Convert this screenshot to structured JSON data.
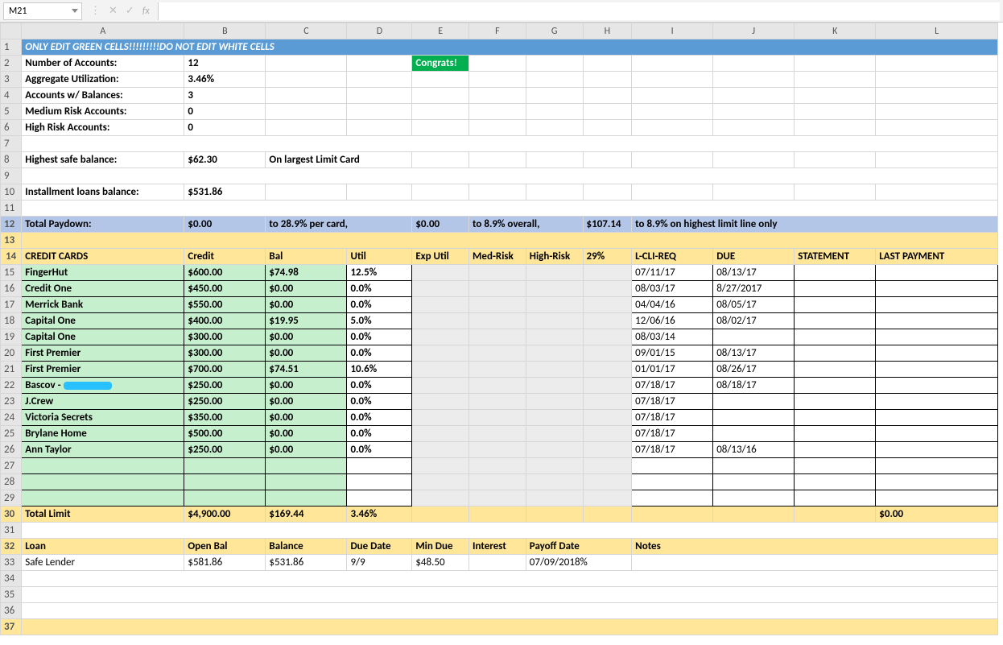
{
  "formula_bar": {
    "name_box": "M21",
    "fx": "fx",
    "value": ""
  },
  "columns": [
    "A",
    "B",
    "C",
    "D",
    "E",
    "F",
    "G",
    "H",
    "I",
    "J",
    "K",
    "L"
  ],
  "row1": {
    "banner": "ONLY EDIT GREEN CELLS!!!!!!!!!DO NOT EDIT WHITE CELLS"
  },
  "congrats": "Congrats!",
  "summary": {
    "num_accounts_label": "Number of Accounts:",
    "num_accounts": "12",
    "agg_util_label": "Aggregate Utilization:",
    "agg_util": "3.46%",
    "accts_bal_label": "Accounts w/ Balances:",
    "accts_bal": "3",
    "med_risk_label": "Medium Risk Accounts:",
    "med_risk": "0",
    "high_risk_label": "High Risk Accounts:",
    "high_risk": "0",
    "highest_safe_label": "Highest safe balance:",
    "highest_safe": "$62.30",
    "highest_safe_note": "On largest Limit Card",
    "installment_label": "Installment loans balance:",
    "installment": "$531.86"
  },
  "paydown": {
    "label": "Total Paydown:",
    "val1": "$0.00",
    "text1": "to 28.9% per card,",
    "val2": "$0.00",
    "text2": "to 8.9% overall,",
    "val3": "$107.14",
    "text3": "to 8.9% on highest limit line only"
  },
  "headers": {
    "cc": "CREDIT CARDS",
    "credit": "Credit",
    "bal": "Bal",
    "util": "Util",
    "exputil": "Exp Util",
    "medrisk": "Med-Risk",
    "highrisk": "High-Risk",
    "p29": "29%",
    "lcli": "L-CLI-REQ",
    "due": "DUE",
    "stmt": "STATEMENT",
    "last": "LAST PAYMENT"
  },
  "cards": [
    {
      "name": "FingerHut",
      "credit": "$600.00",
      "bal": "$74.98",
      "util": "12.5%",
      "lcli": "07/11/17",
      "due": "08/13/17"
    },
    {
      "name": "Credit One",
      "credit": "$450.00",
      "bal": "$0.00",
      "util": "0.0%",
      "lcli": "08/03/17",
      "due": "8/27/2017"
    },
    {
      "name": "Merrick Bank",
      "credit": "$550.00",
      "bal": "$0.00",
      "util": "0.0%",
      "lcli": "04/04/16",
      "due": "08/05/17"
    },
    {
      "name": "Capital One",
      "credit": "$400.00",
      "bal": "$19.95",
      "util": "5.0%",
      "lcli": "12/06/16",
      "due": "08/02/17"
    },
    {
      "name": "Capital One",
      "credit": "$300.00",
      "bal": "$0.00",
      "util": "0.0%",
      "lcli": "08/03/14",
      "due": ""
    },
    {
      "name": "First Premier",
      "credit": "$300.00",
      "bal": "$0.00",
      "util": "0.0%",
      "lcli": "09/01/15",
      "due": "08/13/17"
    },
    {
      "name": "First Premier",
      "credit": "$700.00",
      "bal": "$74.51",
      "util": "10.6%",
      "lcli": "01/01/17",
      "due": "08/26/17"
    },
    {
      "name": "Bascov - ",
      "credit": "$250.00",
      "bal": "$0.00",
      "util": "0.0%",
      "lcli": "07/18/17",
      "due": "08/18/17",
      "redact": true
    },
    {
      "name": "J.Crew",
      "credit": "$250.00",
      "bal": "$0.00",
      "util": "0.0%",
      "lcli": "07/18/17",
      "due": ""
    },
    {
      "name": "Victoria Secrets",
      "credit": "$350.00",
      "bal": "$0.00",
      "util": "0.0%",
      "lcli": "07/18/17",
      "due": ""
    },
    {
      "name": "Brylane Home",
      "credit": "$500.00",
      "bal": "$0.00",
      "util": "0.0%",
      "lcli": "07/18/17",
      "due": ""
    },
    {
      "name": "Ann Taylor",
      "credit": "$250.00",
      "bal": "$0.00",
      "util": "0.0%",
      "lcli": "07/18/17",
      "due": "08/13/16"
    }
  ],
  "totals": {
    "label": "Total Limit",
    "credit": "$4,900.00",
    "bal": "$169.44",
    "util": "3.46%",
    "last": "$0.00"
  },
  "loan_headers": {
    "loan": "Loan",
    "openbal": "Open Bal",
    "balance": "Balance",
    "duedate": "Due Date",
    "mindue": "Min Due",
    "interest": "Interest",
    "payoff": "Payoff Date",
    "notes": "Notes"
  },
  "loans": [
    {
      "name": "Safe Lender",
      "open": "$581.86",
      "bal": "$531.86",
      "due": "9/9",
      "min": "$48.50",
      "interest": "",
      "payoff": "07/09/2018%"
    }
  ]
}
